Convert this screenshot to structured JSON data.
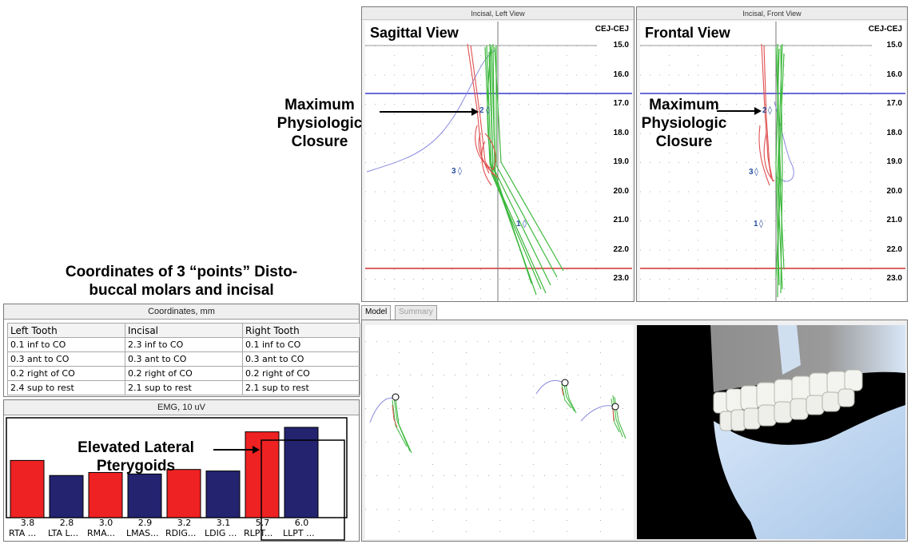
{
  "annotations": {
    "coord_heading_line1": "Coordinates of 3 “points” Disto-",
    "coord_heading_line2": "buccal molars and incisal",
    "sagittal_mpc_line1": "Maximum",
    "sagittal_mpc_line2": "Physiologic",
    "sagittal_mpc_line3": "Closure",
    "frontal_mpc_line1": "Maximum",
    "frontal_mpc_line2": "Physiologic",
    "frontal_mpc_line3": "Closure",
    "elevated_line1": "Elevated Lateral",
    "elevated_line2": "Pterygoids"
  },
  "left_view": {
    "panel_title": "Incisal, Left View",
    "title": "Sagittal View",
    "unit": "CEJ-CEJ"
  },
  "front_view": {
    "panel_title": "Incisal, Front View",
    "title": "Frontal View",
    "unit": "CEJ-CEJ"
  },
  "y_ticks": [
    "15.0",
    "16.0",
    "17.0",
    "18.0",
    "19.0",
    "20.0",
    "21.0",
    "22.0",
    "23.0"
  ],
  "markers": {
    "m1": "1",
    "m2": "2",
    "m3": "3"
  },
  "tabs": {
    "model": "Model",
    "summary": "Summary"
  },
  "coordinates": {
    "title": "Coordinates, mm",
    "headers": [
      "Left Tooth",
      "Incisal",
      "Right Tooth"
    ],
    "rows": [
      [
        "0.1 inf to CO",
        "2.3 inf to CO",
        "0.1 inf to CO"
      ],
      [
        "0.3 ant to CO",
        "0.3 ant to CO",
        "0.3 ant to CO"
      ],
      [
        "0.2 right of CO",
        "0.2 right of CO",
        "0.2 right of CO"
      ],
      [
        "2.4 sup to rest",
        "2.1 sup to rest",
        "2.1 sup to rest"
      ]
    ]
  },
  "emg": {
    "title": "EMG, 10 uV",
    "colors": {
      "red": "#ee2222",
      "blue": "#232370"
    }
  },
  "chart_data": {
    "type": "bar",
    "title": "EMG, 10 uV",
    "categories": [
      "RTA ...",
      "LTA L...",
      "RMA...",
      "LMAS...",
      "RDIG...",
      "LDIG ...",
      "RLPT...",
      "LLPT ..."
    ],
    "values": [
      3.8,
      2.8,
      3.0,
      2.9,
      3.2,
      3.1,
      5.7,
      6.0
    ],
    "value_labels": [
      "3.8",
      "2.8",
      "3.0",
      "2.9",
      "3.2",
      "3.1",
      "5.7",
      "6.0"
    ],
    "bar_colors": [
      "red",
      "blue",
      "red",
      "blue",
      "red",
      "blue",
      "red",
      "blue"
    ],
    "ylim": [
      0,
      6.5
    ]
  }
}
